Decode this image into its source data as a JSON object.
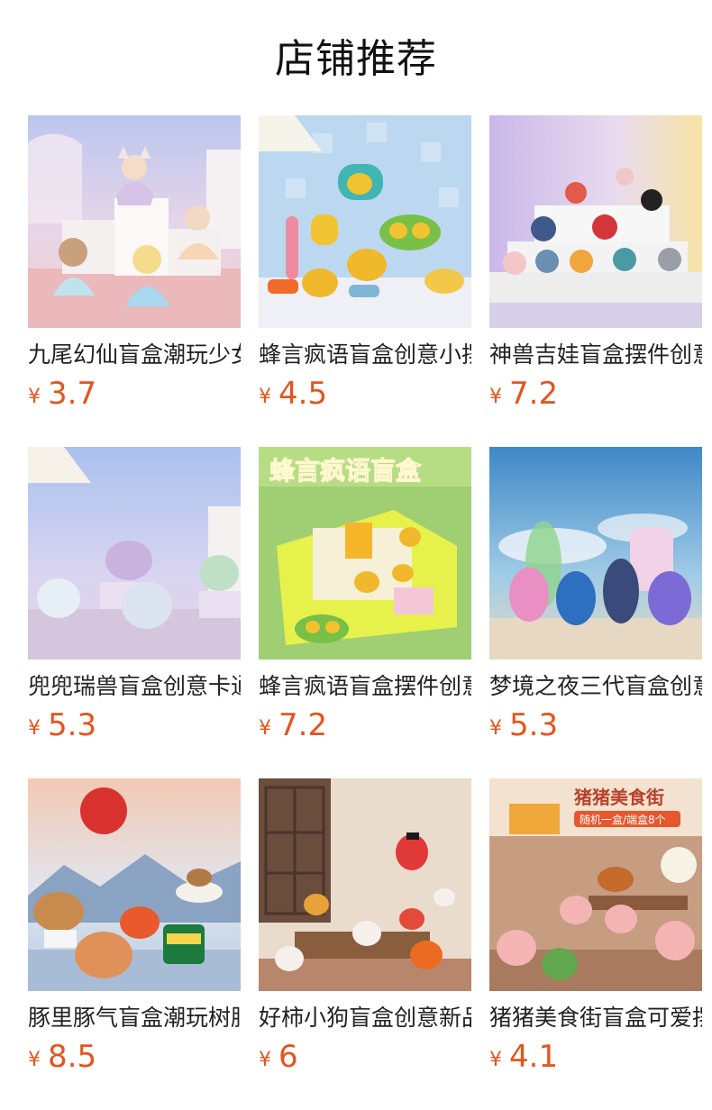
{
  "header": {
    "title": "店铺推荐"
  },
  "currency_symbol": "¥",
  "products": [
    {
      "name": "九尾幻仙盲盒潮玩少女",
      "price": "3.7",
      "image": "nine-tailed-fox-figures"
    },
    {
      "name": "蜂言疯语盲盒创意小摆件",
      "price": "4.5",
      "image": "bee-figures"
    },
    {
      "name": "神兽吉娃盲盒摆件创意",
      "price": "7.2",
      "image": "mythical-beast-figures"
    },
    {
      "name": "兜兜瑞兽盲盒创意卡通",
      "price": "5.3",
      "image": "lucky-beast-figures"
    },
    {
      "name": "蜂言疯语盲盒摆件创意",
      "price": "7.2",
      "image": "bee-box-poster"
    },
    {
      "name": "梦境之夜三代盲盒创意",
      "price": "5.3",
      "image": "dream-night-figures"
    },
    {
      "name": "豚里豚气盲盒潮玩树脂",
      "price": "8.5",
      "image": "capybara-figures"
    },
    {
      "name": "好柿小狗盲盒创意新品",
      "price": "6",
      "image": "persimmon-dog-figures"
    },
    {
      "name": "猪猪美食街盲盒可爱摆件",
      "price": "4.1",
      "image": "pig-food-street-figures"
    }
  ],
  "image_text": {
    "bee_poster_title": "蜂言疯语盲盒",
    "pig_poster_title": "猪猪美食街",
    "pig_poster_sub": "随机一盒/端盒8个"
  }
}
